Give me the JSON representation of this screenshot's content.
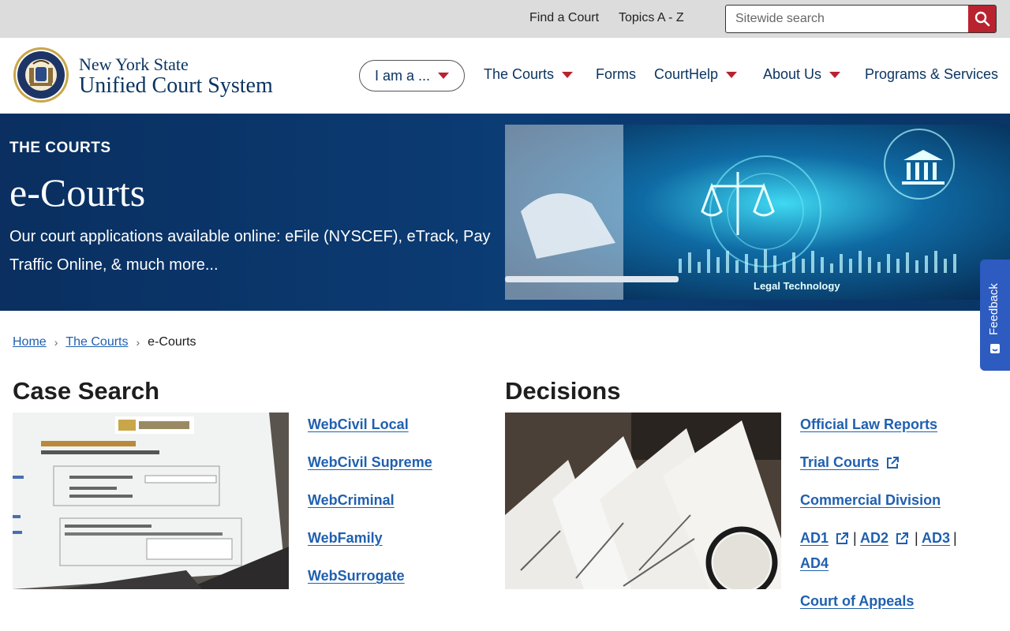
{
  "utility": {
    "find_court": "Find a Court",
    "topics": "Topics A - Z",
    "search_placeholder": "Sitewide search"
  },
  "brand": {
    "line1": "New York State",
    "line2": "Unified Court System"
  },
  "nav": {
    "iam": "I am a ...",
    "courts": "The Courts",
    "forms": "Forms",
    "courthelp": "CourtHelp",
    "about": "About Us",
    "programs": "Programs & Services"
  },
  "hero": {
    "kicker": "THE COURTS",
    "title": "e-Courts",
    "description": "Our court applications available online: eFile (NYSCEF), eTrack, Pay Traffic Online, & much more...",
    "image_caption": "Legal Technology"
  },
  "feedback": "Feedback",
  "breadcrumb": {
    "home": "Home",
    "courts": "The Courts",
    "current": "e-Courts"
  },
  "case_search": {
    "title": "Case Search",
    "links": [
      "WebCivil Local",
      "WebCivil Supreme",
      "WebCriminal",
      "WebFamily",
      "WebSurrogate"
    ]
  },
  "decisions": {
    "title": "Decisions",
    "links": {
      "law_reports": "Official Law Reports",
      "trial_courts": "Trial Courts",
      "commercial": "Commercial Division",
      "ad1": "AD1",
      "ad2": "AD2",
      "ad3": "AD3",
      "ad4": "AD4",
      "appeals": "Court of Appeals"
    }
  },
  "colors": {
    "navy": "#0b3561",
    "accent_red": "#b8232f",
    "link_blue": "#2060b0",
    "feedback_blue": "#2d5bbf"
  }
}
